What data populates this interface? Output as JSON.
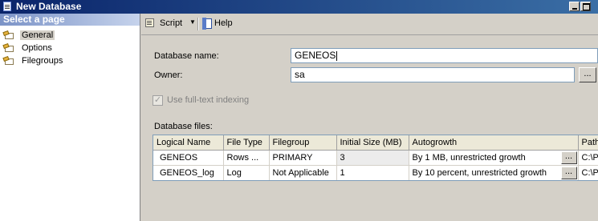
{
  "window": {
    "title": "New Database"
  },
  "sidebar": {
    "header": "Select a page",
    "items": [
      {
        "label": "General",
        "selected": true
      },
      {
        "label": "Options",
        "selected": false
      },
      {
        "label": "Filegroups",
        "selected": false
      }
    ]
  },
  "toolbar": {
    "script_label": "Script",
    "help_label": "Help"
  },
  "form": {
    "db_name_label": "Database name:",
    "db_name_value": "GENEOS",
    "owner_label": "Owner:",
    "owner_value": "sa",
    "browse_label": "...",
    "fulltext_label": "Use full-text indexing",
    "fulltext_checked": true,
    "db_files_label": "Database files:"
  },
  "files_table": {
    "columns": [
      "Logical Name",
      "File Type",
      "Filegroup",
      "Initial Size (MB)",
      "Autogrowth",
      "Path"
    ],
    "rows": [
      {
        "logical_name": "GENEOS",
        "file_type": "Rows ...",
        "filegroup": "PRIMARY",
        "initial_size": "3",
        "autogrowth": "By 1 MB, unrestricted growth",
        "path": "C:\\P"
      },
      {
        "logical_name": "GENEOS_log",
        "file_type": "Log",
        "filegroup": "Not Applicable",
        "initial_size": "1",
        "autogrowth": "By 10 percent, unrestricted growth",
        "path": "C:\\P"
      }
    ],
    "cell_button_label": "..."
  },
  "colors": {
    "titlebar": "#0a246a",
    "panel_header": "#7b93c7",
    "window_bg": "#d4d0c8"
  }
}
